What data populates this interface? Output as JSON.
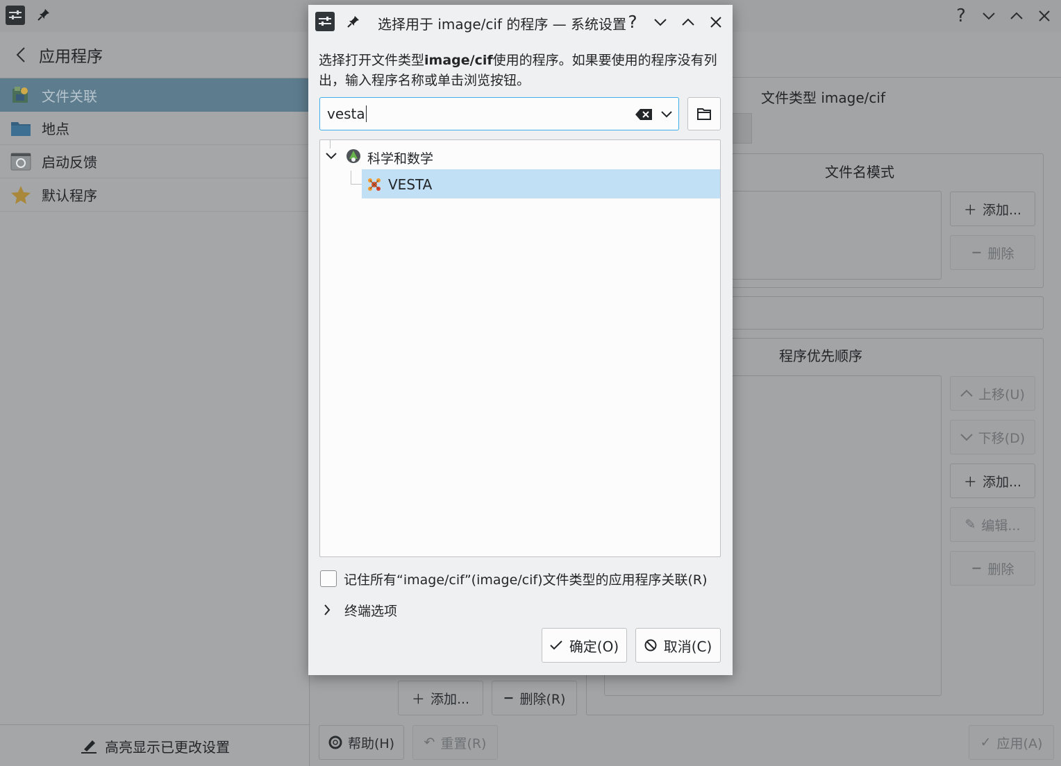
{
  "window": {
    "controls": [
      "?",
      "chevron-down",
      "chevron-up",
      "close"
    ]
  },
  "sidebar": {
    "back_title": "应用程序",
    "items": [
      {
        "label": "文件关联",
        "icon": "file-associations-icon",
        "selected": true
      },
      {
        "label": "地点",
        "icon": "folder-icon"
      },
      {
        "label": "启动反馈",
        "icon": "launch-feedback-icon"
      },
      {
        "label": "默认程序",
        "icon": "star-icon"
      }
    ],
    "highlight_label": "高亮显示已更改设置"
  },
  "main": {
    "filetype_title": "文件类型 image/cif",
    "filename_patterns_title": "文件名模式",
    "add_label": "添加...",
    "delete_label": "删除",
    "app_order_title": "程序优先顺序",
    "move_up_label": "上移(U)",
    "move_down_label": "下移(D)",
    "add2_label": "添加...",
    "edit_label": "编辑...",
    "delete2_label": "删除",
    "add_bottom_label": "添加...",
    "delete_bottom_label": "删除(R)",
    "help_label": "帮助(H)",
    "reset_label": "重置(R)",
    "apply_label": "应用(A)"
  },
  "dialog": {
    "title": "选择用于 image/cif 的程序 — 系统设置",
    "description_pre": "选择打开文件类型",
    "description_bold": "image/cif",
    "description_post": "使用的程序。如果要使用的程序没有列出，输入程序名称或单击浏览按钮。",
    "search_value": "vesta",
    "tree": {
      "category": "科学和数学",
      "app": "VESTA"
    },
    "remember_label": "记住所有“image/cif”(image/cif)文件类型的应用程序关联(R)",
    "remember_checked": false,
    "terminal_options_label": "终端选项",
    "ok_label": "确定(O)",
    "cancel_label": "取消(C)"
  },
  "colors": {
    "selection": "#c2e0f5",
    "sidebar_selected": "#5d7c8e",
    "focus_border": "#3daee9"
  }
}
